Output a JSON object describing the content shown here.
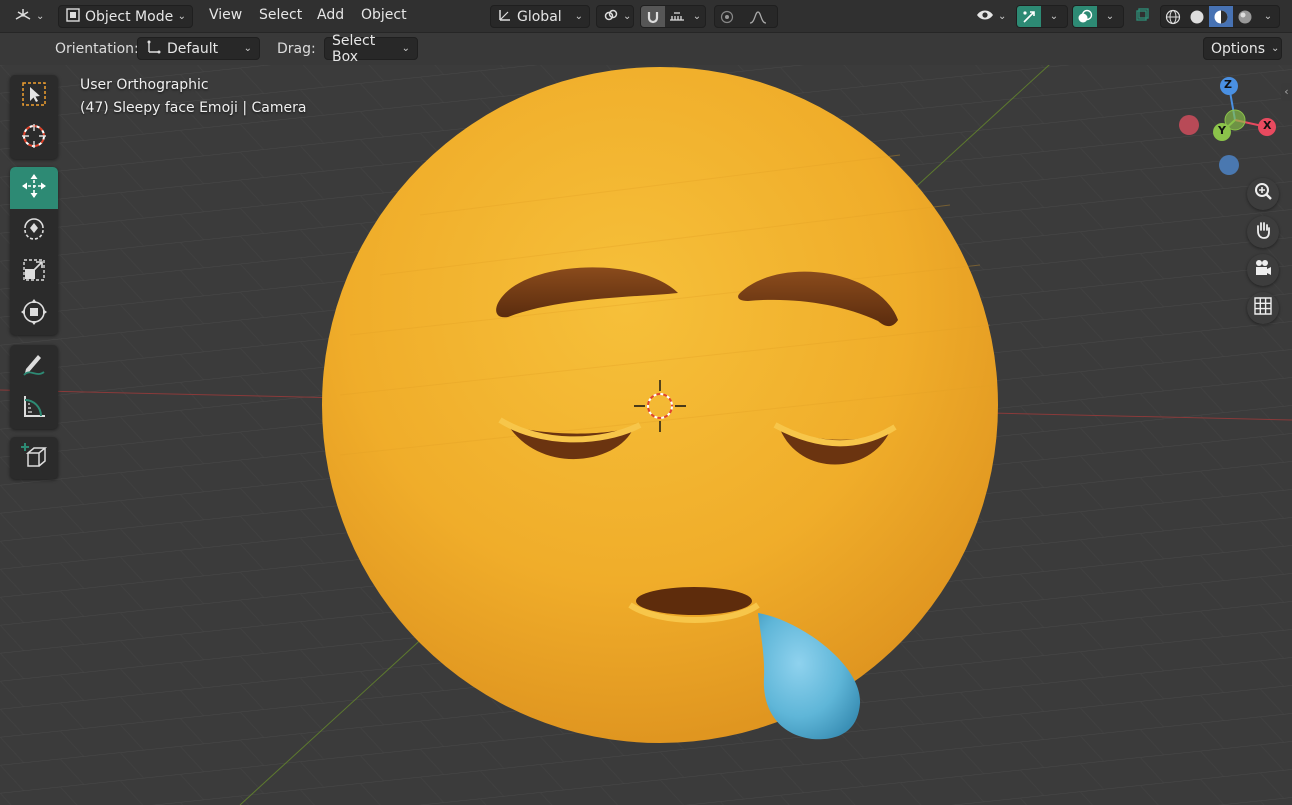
{
  "header": {
    "editor_type_icon": "3d-viewport-icon",
    "mode": "Object Mode",
    "menus": [
      "View",
      "Select",
      "Add",
      "Object"
    ],
    "transform_orientation": "Global",
    "pivot_icon": "link-pivot-icon",
    "snap_icon": "magnet-icon",
    "snap_increment_icon": "increment-icon",
    "proportional_icon": "proportional-edit-icon",
    "falloff_icon": "falloff-curve-icon",
    "visibility_icon": "eye-icon",
    "gizmo_icon": "gizmo-icon",
    "overlay_icon": "overlay-icon",
    "xray_icon": "xray-icon",
    "shading_modes": [
      "wireframe",
      "solid",
      "material-preview",
      "rendered"
    ],
    "active_shading": "material-preview"
  },
  "tool_settings": {
    "orientation_label": "Orientation:",
    "orientation_value": "Default",
    "drag_label": "Drag:",
    "drag_value": "Select Box",
    "options_label": "Options"
  },
  "viewport": {
    "view_name": "User Orthographic",
    "object_info": "(47) Sleepy face Emoji | Camera",
    "gizmo": {
      "z": "Z",
      "y": "Y",
      "x": "X"
    }
  },
  "tools": [
    {
      "name": "select-box-tool",
      "icon": "select-box-icon",
      "active": false
    },
    {
      "name": "cursor-tool",
      "icon": "cursor-icon",
      "active": false
    },
    {
      "name": "move-tool",
      "icon": "move-icon",
      "active": true
    },
    {
      "name": "rotate-tool",
      "icon": "rotate-icon",
      "active": false
    },
    {
      "name": "scale-tool",
      "icon": "scale-icon",
      "active": false
    },
    {
      "name": "transform-tool",
      "icon": "transform-icon",
      "active": false
    },
    {
      "name": "annotate-tool",
      "icon": "annotate-icon",
      "active": false
    },
    {
      "name": "measure-tool",
      "icon": "measure-icon",
      "active": false
    },
    {
      "name": "add-cube-tool",
      "icon": "add-cube-icon",
      "active": false
    }
  ],
  "nav_buttons": [
    "zoom-icon",
    "hand-icon",
    "camera-icon",
    "grid-icon"
  ],
  "colors": {
    "active_tool": "#2d8a74",
    "emoji_yellow": "#f3b62c",
    "tear_blue": "#5fb6d8",
    "axis_x": "#e84a5f",
    "axis_y": "#8bc34a",
    "axis_z": "#4a90e2"
  }
}
